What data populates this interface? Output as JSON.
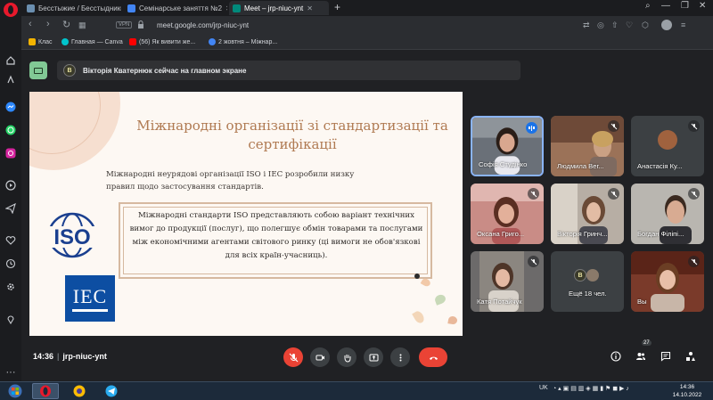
{
  "browser": {
    "tabs": [
      {
        "label": "Бесстыжие / Бесстыдники",
        "favicon_color": "#6b8fb0",
        "active": false
      },
      {
        "label": "Семінарське заняття №2",
        "favicon_color": "#4285f4",
        "active": false
      },
      {
        "label": "Meet – jrp-niuc-ynt",
        "favicon_color": "#00897b",
        "active": true
      }
    ],
    "new_tab_symbol": "+",
    "vpn_label": "VPN",
    "url": "meet.google.com/jrp-niuc-ynt",
    "bookmarks": [
      {
        "label": "Клас",
        "favicon_color": "#f4b400"
      },
      {
        "label": "Главная — Canva",
        "favicon_color": "#00c4cc"
      },
      {
        "label": "(56) Як вивити же...",
        "favicon_color": "#ff0000"
      },
      {
        "label": "2 жовтня – Міжнар...",
        "favicon_color": "#4285f4"
      }
    ]
  },
  "meet": {
    "presenter_banner": "Вікторія Кватернюк сейчас на главном экране",
    "presenter_initial": "В",
    "slide": {
      "title": "Міжнародні організації зі стандартизації та сертифікації",
      "intro": "Міжнародні неурядові організації ISO і IEC розробили низку правил щодо застосування стандартів.",
      "quote": "Міжнародні стандарти ISO представляють собою варіант технічних вимог до продукції (послуг), що полегшує обмін товарами та послугами між економічними агентами світового ринку (ці вимоги не обов'язкові для всіх країн-учасниць).",
      "logo_iso": "ISO",
      "logo_iec": "IEC"
    },
    "participants": [
      {
        "name": "Софія Студінко",
        "speaking": true,
        "muted": false
      },
      {
        "name": "Людмила Вег...",
        "muted": true
      },
      {
        "name": "Анастасія Ку...",
        "muted": true
      },
      {
        "name": "Оксана Григо...",
        "muted": true
      },
      {
        "name": "Вікторія Гринч...",
        "muted": true
      },
      {
        "name": "Богдан Філіпі...",
        "muted": true
      },
      {
        "name": "Катя Потайчук",
        "muted": true
      },
      {
        "name": "Ещё 18 чел.",
        "muted": false
      },
      {
        "name": "Вы",
        "muted": true
      }
    ],
    "meeting_time": "14:36",
    "meeting_code": "jrp-niuc-ynt",
    "participant_count": "27"
  },
  "taskbar": {
    "language": "UK",
    "time": "14:36",
    "date": "14.10.2022"
  }
}
